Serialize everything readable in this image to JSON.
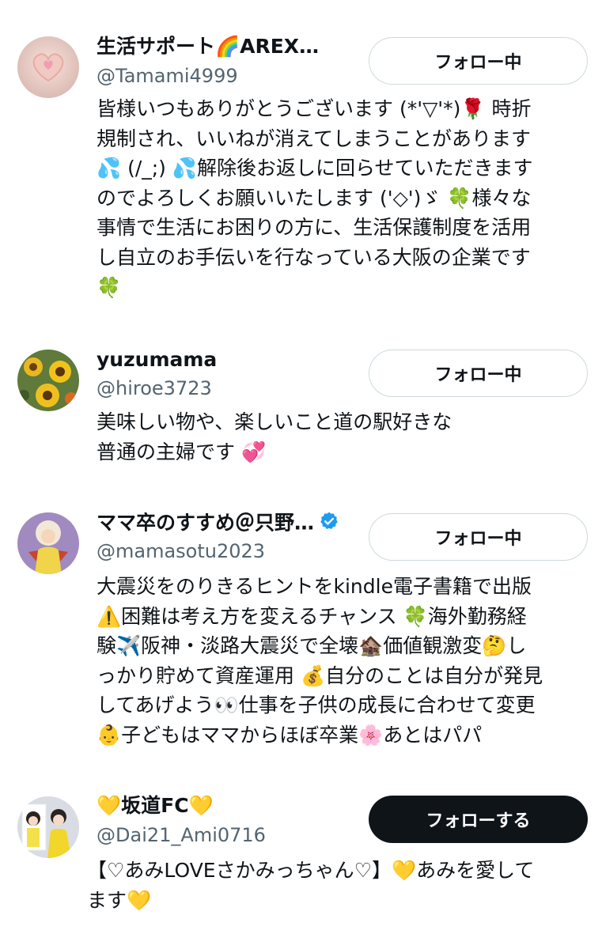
{
  "users": [
    {
      "name": "生活サポート🌈AREX…",
      "handle": "@Tamami4999",
      "button": "フォロー中",
      "bio": "皆様いつもありがとうございます (*'▽'*)🌹 時折\n規制され、いいねが消えてしまうことがあります\n💦 (/_;) 💦解除後お返しに回らせていただきます\nのでよろしくお願いいたします ('◇')ゞ 🍀様々な\n事情で生活にお困りの方に、生活保護制度を活用\nし自立のお手伝いを行なっている大阪の企業です\n🍀"
    },
    {
      "name": "yuzumama",
      "handle": "@hiroe3723",
      "button": "フォロー中",
      "bio": "美味しい物や、楽しいこと道の駅好きな\n普通の主婦です 💞"
    },
    {
      "name": "ママ卒のすすめ＠只野…",
      "handle": "@mamasotu2023",
      "button": "フォロー中",
      "bio": "大震災をのりきるヒントをkindle電子書籍で出版\n⚠️困難は考え方を変えるチャンス 🍀海外勤務経\n験✈️阪神・淡路大震災で全壊🏚️価値観激変🤔し\nっかり貯めて資産運用 💰自分のことは自分が発見\nしてあげよう👀仕事を子供の成長に合わせて変更\n👶子どもはママからほぼ卒業🌸あとはパパ"
    },
    {
      "name": "💛坂道FC💛",
      "handle": "@Dai21_Ami0716",
      "button": "フォローする",
      "bio": "【♡あみLOVEさかみっちゃん♡】💛あみを愛して\nます💛"
    }
  ],
  "colors": {
    "verified": "#1d9bf0",
    "follow_bg": "#0f1419",
    "handle": "#536471"
  },
  "icons": {
    "verified": "verified-badge-icon"
  }
}
